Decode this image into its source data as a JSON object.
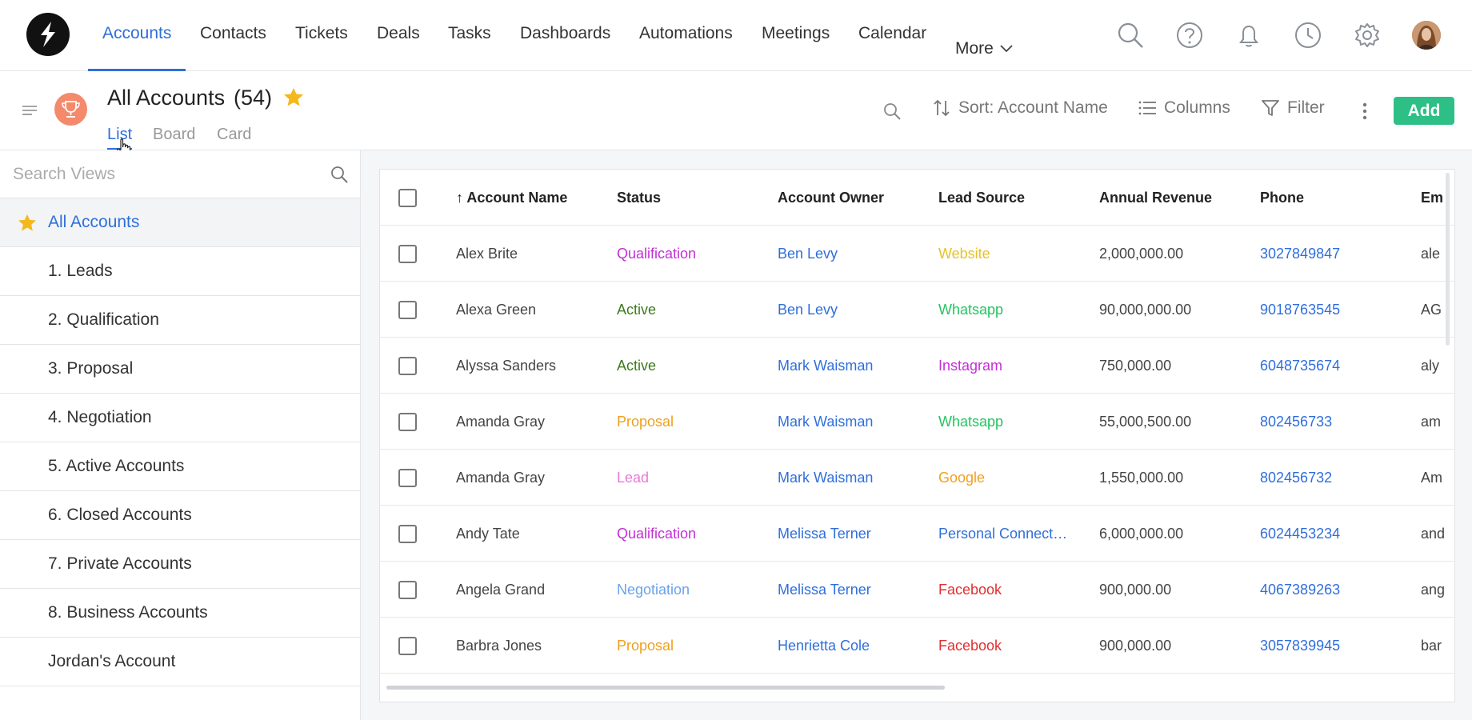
{
  "nav": {
    "items": [
      {
        "label": "Accounts",
        "active": true
      },
      {
        "label": "Contacts"
      },
      {
        "label": "Tickets"
      },
      {
        "label": "Deals"
      },
      {
        "label": "Tasks"
      },
      {
        "label": "Dashboards"
      },
      {
        "label": "Automations"
      },
      {
        "label": "Meetings"
      },
      {
        "label": "Calendar"
      }
    ],
    "more_label": "More",
    "icons": [
      "search-icon",
      "help-icon",
      "bell-icon",
      "clock-icon",
      "gear-icon"
    ],
    "accent": "#2f6fdb"
  },
  "header": {
    "title": "All Accounts",
    "count": "(54)",
    "tabs": [
      {
        "label": "List",
        "active": true
      },
      {
        "label": "Board"
      },
      {
        "label": "Card"
      }
    ],
    "sort_label": "Sort: Account Name",
    "columns_label": "Columns",
    "filter_label": "Filter",
    "add_label": "Add",
    "add_color": "#2dbf86",
    "icon_color": "#f4896b"
  },
  "sidebar": {
    "search_placeholder": "Search Views",
    "items": [
      {
        "label": "All Accounts",
        "active": true,
        "starred": true
      },
      {
        "label": "1. Leads"
      },
      {
        "label": "2. Qualification"
      },
      {
        "label": "3. Proposal"
      },
      {
        "label": "4. Negotiation"
      },
      {
        "label": "5. Active Accounts"
      },
      {
        "label": "6. Closed Accounts"
      },
      {
        "label": "7. Private Accounts"
      },
      {
        "label": "8. Business Accounts"
      },
      {
        "label": "Jordan's Account"
      }
    ]
  },
  "table": {
    "columns": [
      "Account Name",
      "Status",
      "Account Owner",
      "Lead Source",
      "Annual Revenue",
      "Phone",
      "Em"
    ],
    "sort_indicator": "↑",
    "rows": [
      {
        "name": "Alex Brite",
        "status": "Qualification",
        "status_color": "#c42fd6",
        "owner": "Ben Levy",
        "source": "Website",
        "source_color": "#e6c229",
        "revenue": "2,000,000.00",
        "phone": "3027849847",
        "email": "ale"
      },
      {
        "name": "Alexa Green",
        "status": "Active",
        "status_color": "#3d7a1e",
        "owner": "Ben Levy",
        "source": "Whatsapp",
        "source_color": "#22c55e",
        "revenue": "90,000,000.00",
        "phone": "9018763545",
        "email": "AG"
      },
      {
        "name": "Alyssa Sanders",
        "status": "Active",
        "status_color": "#3d7a1e",
        "owner": "Mark Waisman",
        "source": "Instagram",
        "source_color": "#c42fd6",
        "revenue": "750,000.00",
        "phone": "6048735674",
        "email": "aly"
      },
      {
        "name": "Amanda Gray",
        "status": "Proposal",
        "status_color": "#f0a01e",
        "owner": "Mark Waisman",
        "source": "Whatsapp",
        "source_color": "#22c55e",
        "revenue": "55,000,500.00",
        "phone": "802456733",
        "email": "am"
      },
      {
        "name": "Amanda Gray",
        "status": "Lead",
        "status_color": "#e87ad9",
        "owner": "Mark Waisman",
        "source": "Google",
        "source_color": "#f0a01e",
        "revenue": "1,550,000.00",
        "phone": "802456732",
        "email": "Am"
      },
      {
        "name": "Andy Tate",
        "status": "Qualification",
        "status_color": "#c42fd6",
        "owner": "Melissa Terner",
        "source": "Personal Connect…",
        "source_color": "#2f6fdb",
        "revenue": "6,000,000.00",
        "phone": "6024453234",
        "email": "and"
      },
      {
        "name": "Angela Grand",
        "status": "Negotiation",
        "status_color": "#6aa3e8",
        "owner": "Melissa Terner",
        "source": "Facebook",
        "source_color": "#e03030",
        "revenue": "900,000.00",
        "phone": "4067389263",
        "email": "ang"
      },
      {
        "name": "Barbra Jones",
        "status": "Proposal",
        "status_color": "#f0a01e",
        "owner": "Henrietta Cole",
        "source": "Facebook",
        "source_color": "#e03030",
        "revenue": "900,000.00",
        "phone": "3057839945",
        "email": "bar"
      }
    ]
  }
}
